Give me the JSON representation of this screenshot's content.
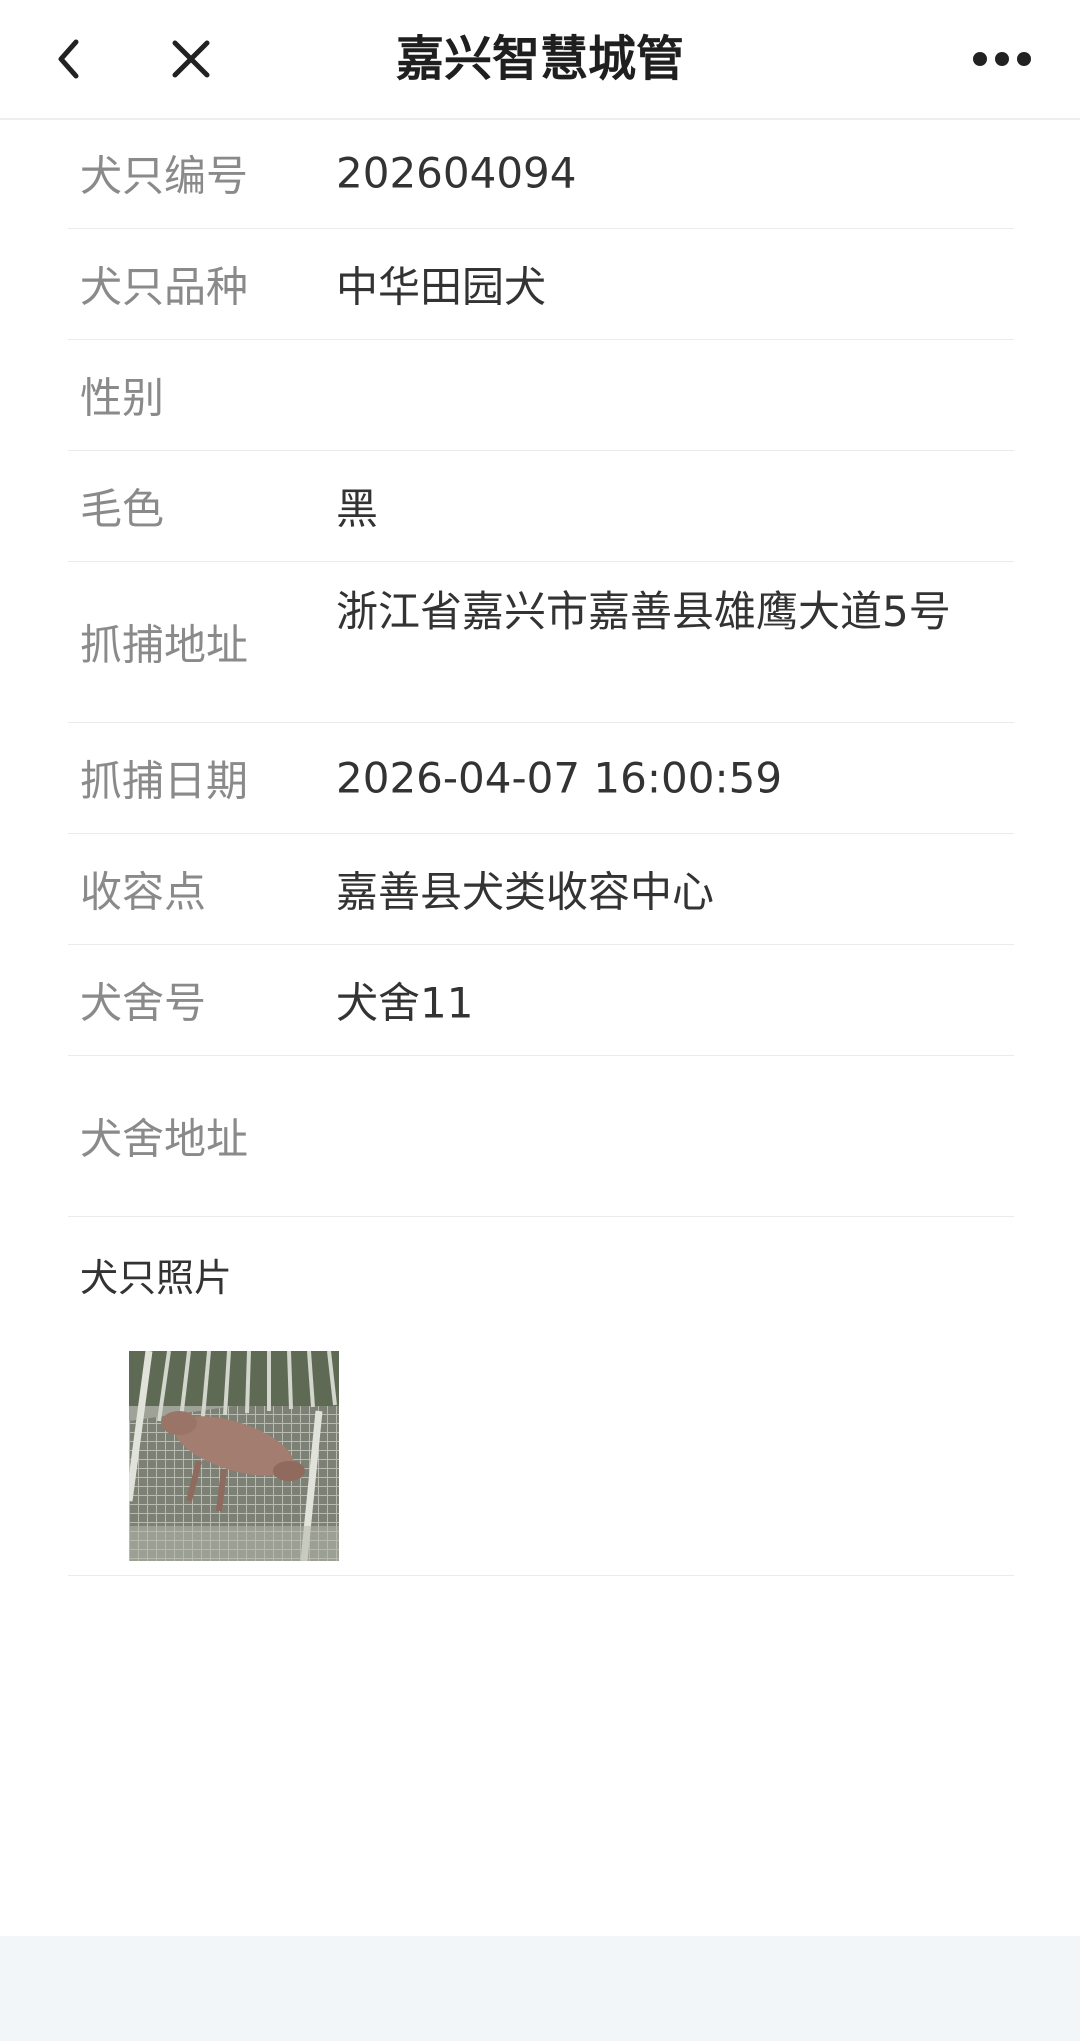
{
  "navbar": {
    "title": "嘉兴智慧城管",
    "back_icon": "chevron-left-icon",
    "close_icon": "close-icon",
    "more_icon": "more-horizontal-icon"
  },
  "fields": [
    {
      "label": "犬只编号",
      "value": "202604094"
    },
    {
      "label": "犬只品种",
      "value": "中华田园犬"
    },
    {
      "label": "性别",
      "value": ""
    },
    {
      "label": "毛色",
      "value": "黑"
    },
    {
      "label": "抓捕地址",
      "value": "浙江省嘉兴市嘉善县雄鹰大道5号"
    },
    {
      "label": "抓捕日期",
      "value": "2026-04-07 16:00:59"
    },
    {
      "label": "收容点",
      "value": "嘉善县犬类收容中心"
    },
    {
      "label": "犬舍号",
      "value": "犬舍11"
    },
    {
      "label": "犬舍地址",
      "value": ""
    }
  ],
  "photos": {
    "label": "犬只照片"
  }
}
